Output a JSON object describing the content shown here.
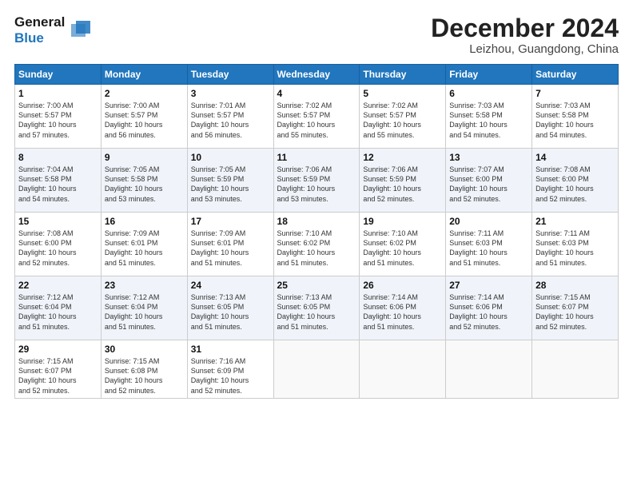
{
  "header": {
    "logo_line1": "General",
    "logo_line2": "Blue",
    "month_title": "December 2024",
    "location": "Leizhou, Guangdong, China"
  },
  "weekdays": [
    "Sunday",
    "Monday",
    "Tuesday",
    "Wednesday",
    "Thursday",
    "Friday",
    "Saturday"
  ],
  "weeks": [
    [
      {
        "day": "1",
        "info": "Sunrise: 7:00 AM\nSunset: 5:57 PM\nDaylight: 10 hours\nand 57 minutes."
      },
      {
        "day": "2",
        "info": "Sunrise: 7:00 AM\nSunset: 5:57 PM\nDaylight: 10 hours\nand 56 minutes."
      },
      {
        "day": "3",
        "info": "Sunrise: 7:01 AM\nSunset: 5:57 PM\nDaylight: 10 hours\nand 56 minutes."
      },
      {
        "day": "4",
        "info": "Sunrise: 7:02 AM\nSunset: 5:57 PM\nDaylight: 10 hours\nand 55 minutes."
      },
      {
        "day": "5",
        "info": "Sunrise: 7:02 AM\nSunset: 5:57 PM\nDaylight: 10 hours\nand 55 minutes."
      },
      {
        "day": "6",
        "info": "Sunrise: 7:03 AM\nSunset: 5:58 PM\nDaylight: 10 hours\nand 54 minutes."
      },
      {
        "day": "7",
        "info": "Sunrise: 7:03 AM\nSunset: 5:58 PM\nDaylight: 10 hours\nand 54 minutes."
      }
    ],
    [
      {
        "day": "8",
        "info": "Sunrise: 7:04 AM\nSunset: 5:58 PM\nDaylight: 10 hours\nand 54 minutes."
      },
      {
        "day": "9",
        "info": "Sunrise: 7:05 AM\nSunset: 5:58 PM\nDaylight: 10 hours\nand 53 minutes."
      },
      {
        "day": "10",
        "info": "Sunrise: 7:05 AM\nSunset: 5:59 PM\nDaylight: 10 hours\nand 53 minutes."
      },
      {
        "day": "11",
        "info": "Sunrise: 7:06 AM\nSunset: 5:59 PM\nDaylight: 10 hours\nand 53 minutes."
      },
      {
        "day": "12",
        "info": "Sunrise: 7:06 AM\nSunset: 5:59 PM\nDaylight: 10 hours\nand 52 minutes."
      },
      {
        "day": "13",
        "info": "Sunrise: 7:07 AM\nSunset: 6:00 PM\nDaylight: 10 hours\nand 52 minutes."
      },
      {
        "day": "14",
        "info": "Sunrise: 7:08 AM\nSunset: 6:00 PM\nDaylight: 10 hours\nand 52 minutes."
      }
    ],
    [
      {
        "day": "15",
        "info": "Sunrise: 7:08 AM\nSunset: 6:00 PM\nDaylight: 10 hours\nand 52 minutes."
      },
      {
        "day": "16",
        "info": "Sunrise: 7:09 AM\nSunset: 6:01 PM\nDaylight: 10 hours\nand 51 minutes."
      },
      {
        "day": "17",
        "info": "Sunrise: 7:09 AM\nSunset: 6:01 PM\nDaylight: 10 hours\nand 51 minutes."
      },
      {
        "day": "18",
        "info": "Sunrise: 7:10 AM\nSunset: 6:02 PM\nDaylight: 10 hours\nand 51 minutes."
      },
      {
        "day": "19",
        "info": "Sunrise: 7:10 AM\nSunset: 6:02 PM\nDaylight: 10 hours\nand 51 minutes."
      },
      {
        "day": "20",
        "info": "Sunrise: 7:11 AM\nSunset: 6:03 PM\nDaylight: 10 hours\nand 51 minutes."
      },
      {
        "day": "21",
        "info": "Sunrise: 7:11 AM\nSunset: 6:03 PM\nDaylight: 10 hours\nand 51 minutes."
      }
    ],
    [
      {
        "day": "22",
        "info": "Sunrise: 7:12 AM\nSunset: 6:04 PM\nDaylight: 10 hours\nand 51 minutes."
      },
      {
        "day": "23",
        "info": "Sunrise: 7:12 AM\nSunset: 6:04 PM\nDaylight: 10 hours\nand 51 minutes."
      },
      {
        "day": "24",
        "info": "Sunrise: 7:13 AM\nSunset: 6:05 PM\nDaylight: 10 hours\nand 51 minutes."
      },
      {
        "day": "25",
        "info": "Sunrise: 7:13 AM\nSunset: 6:05 PM\nDaylight: 10 hours\nand 51 minutes."
      },
      {
        "day": "26",
        "info": "Sunrise: 7:14 AM\nSunset: 6:06 PM\nDaylight: 10 hours\nand 51 minutes."
      },
      {
        "day": "27",
        "info": "Sunrise: 7:14 AM\nSunset: 6:06 PM\nDaylight: 10 hours\nand 52 minutes."
      },
      {
        "day": "28",
        "info": "Sunrise: 7:15 AM\nSunset: 6:07 PM\nDaylight: 10 hours\nand 52 minutes."
      }
    ],
    [
      {
        "day": "29",
        "info": "Sunrise: 7:15 AM\nSunset: 6:07 PM\nDaylight: 10 hours\nand 52 minutes."
      },
      {
        "day": "30",
        "info": "Sunrise: 7:15 AM\nSunset: 6:08 PM\nDaylight: 10 hours\nand 52 minutes."
      },
      {
        "day": "31",
        "info": "Sunrise: 7:16 AM\nSunset: 6:09 PM\nDaylight: 10 hours\nand 52 minutes."
      },
      {
        "day": "",
        "info": ""
      },
      {
        "day": "",
        "info": ""
      },
      {
        "day": "",
        "info": ""
      },
      {
        "day": "",
        "info": ""
      }
    ]
  ]
}
